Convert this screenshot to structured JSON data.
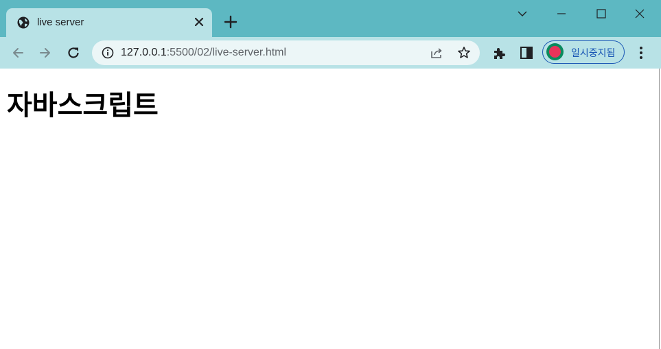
{
  "tab": {
    "title": "live server",
    "icon": "globe-icon"
  },
  "address_bar": {
    "url_host": "127.0.0.1",
    "url_path": ":5500/02/live-server.html"
  },
  "profile": {
    "label": "일시중지됨",
    "icon": "avatar"
  },
  "page": {
    "heading": "자바스크립트"
  },
  "colors": {
    "titlebar": "#5db8c2",
    "toolbar": "#b8e2e6",
    "omnibox": "#ecf6f7",
    "profile_accent": "#1a57b5"
  }
}
